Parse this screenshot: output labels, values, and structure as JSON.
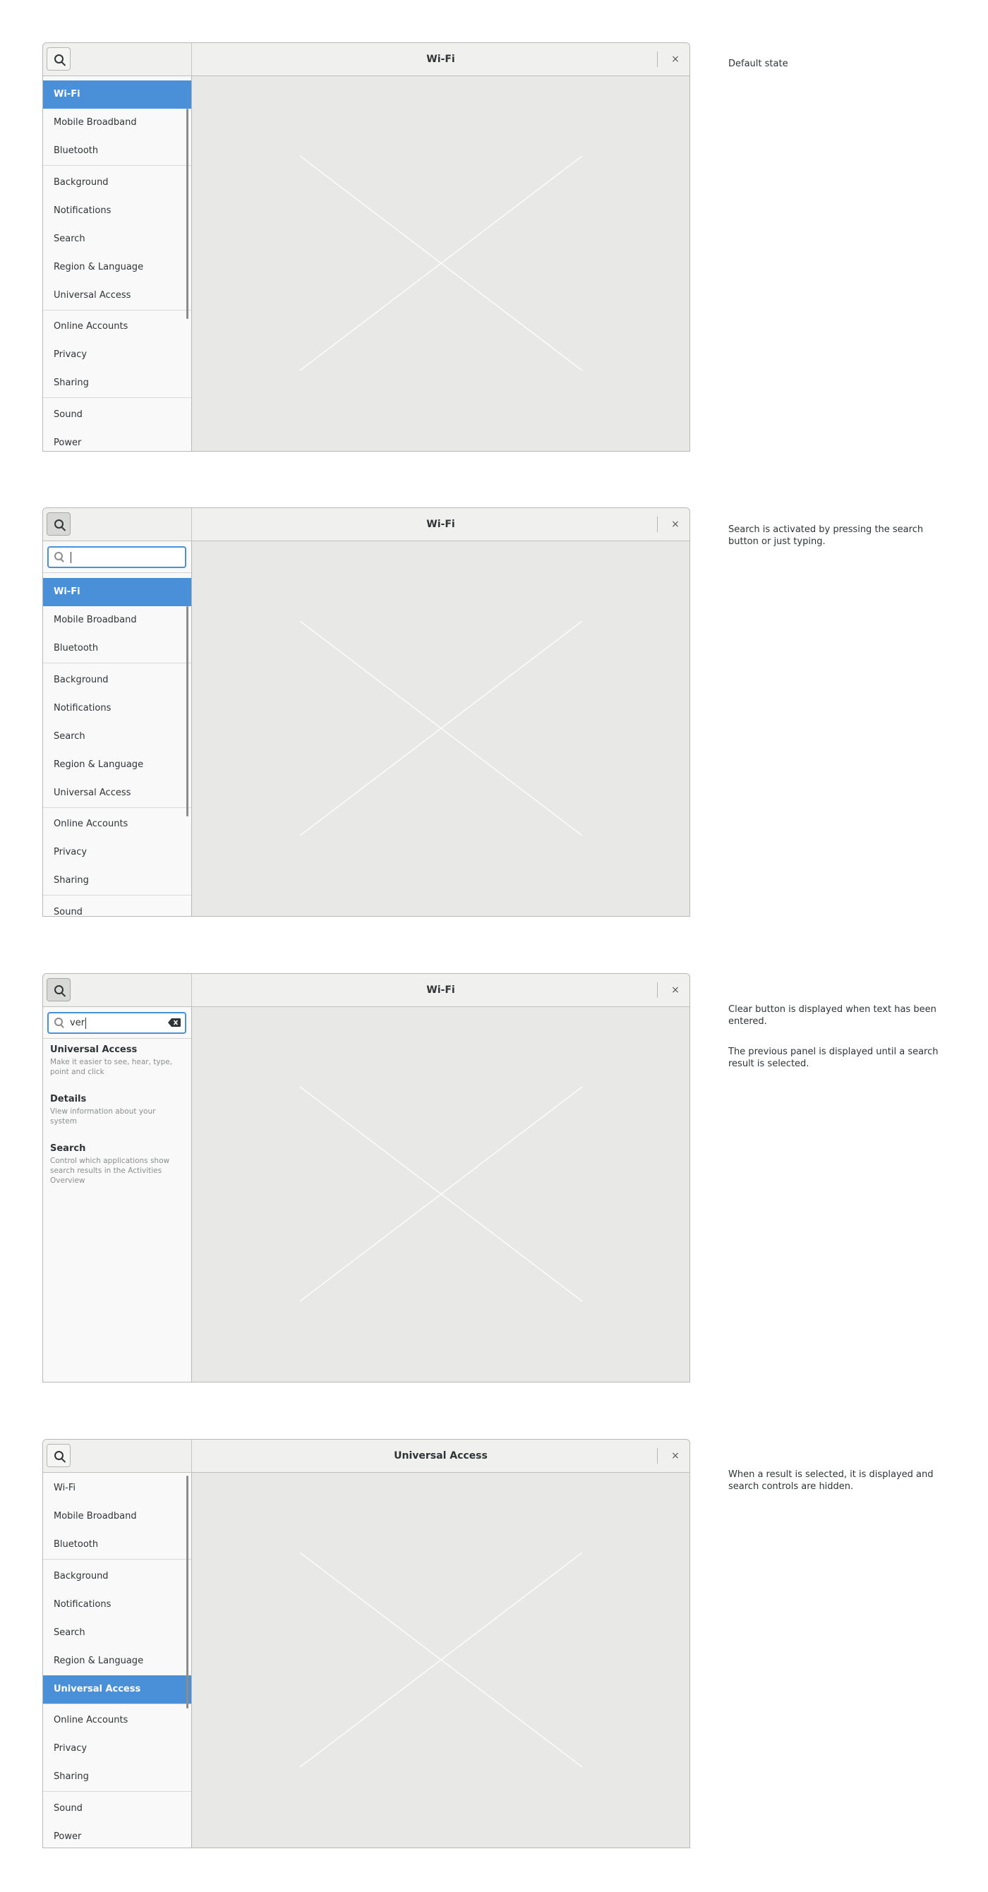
{
  "nav_items": [
    "Wi-Fi",
    "Mobile Broadband",
    "Bluetooth",
    "Background",
    "Notifications",
    "Search",
    "Region & Language",
    "Universal Access",
    "Online Accounts",
    "Privacy",
    "Sharing",
    "Sound",
    "Power"
  ],
  "close_glyph": "×",
  "mockups": [
    {
      "title": "Wi-Fi",
      "note": "Default state",
      "selected": "Wi-Fi"
    },
    {
      "title": "Wi-Fi",
      "note": "Search is activated by pressing the search button or just typing.",
      "search_value": ""
    },
    {
      "title": "Wi-Fi",
      "note_1": "Clear button is displayed when text has been entered.",
      "note_2": "The previous panel is displayed until a search result is selected.",
      "search_value": "ver",
      "results": [
        {
          "title": "Universal Access",
          "desc": "Make it easier to see, hear, type, point and click"
        },
        {
          "title": "Details",
          "desc": "View information about your system"
        },
        {
          "title": "Search",
          "desc": "Control which applications show search results in the Activities Overview"
        }
      ]
    },
    {
      "title": "Universal Access",
      "note": "When a result is selected, it is displayed and search controls are hidden.",
      "selected": "Universal Access"
    }
  ],
  "icons": [
    "search-icon",
    "close-icon",
    "clear-text-icon",
    "placeholder-cross"
  ]
}
